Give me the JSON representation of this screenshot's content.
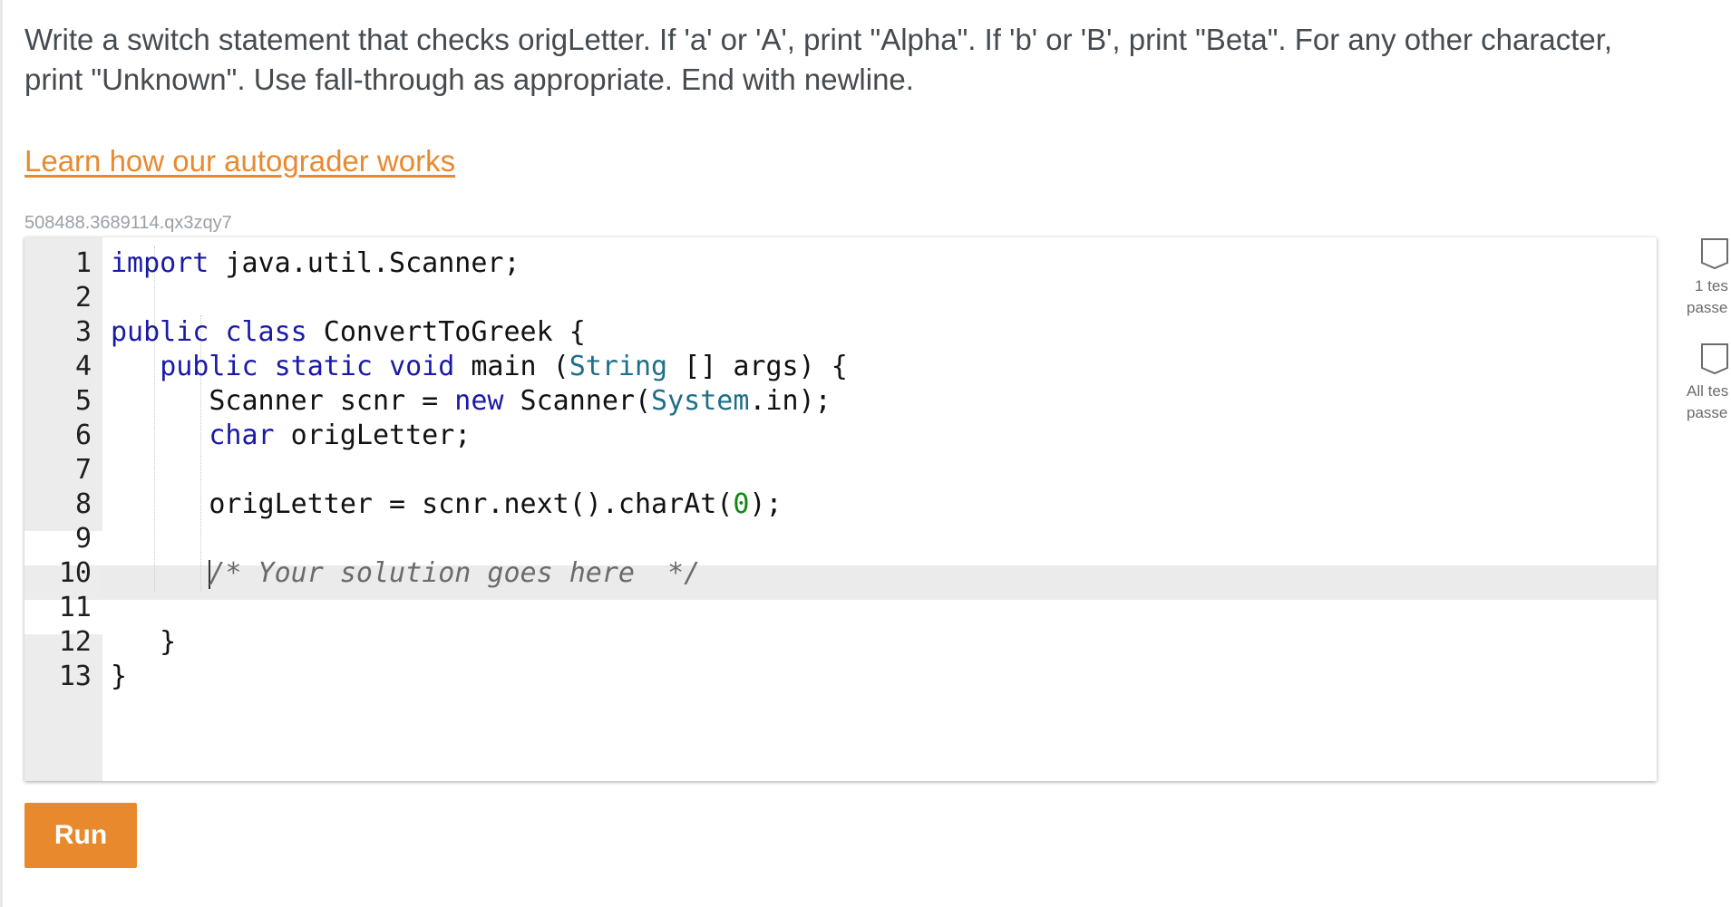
{
  "prompt": {
    "text": "Write a switch statement that checks origLetter. If 'a' or 'A', print \"Alpha\". If 'b' or 'B', print \"Beta\". For any other character, print \"Unknown\". Use fall-through as appropriate. End with newline."
  },
  "learn_link": "Learn how our autograder works",
  "challenge_id": "508488.3689114.qx3zqy7",
  "editor": {
    "active_line": 10,
    "lines": [
      {
        "num": "1",
        "parts": [
          {
            "t": "import",
            "c": "kw"
          },
          {
            "t": " java.util.Scanner;",
            "c": ""
          }
        ]
      },
      {
        "num": "2",
        "parts": []
      },
      {
        "num": "3",
        "parts": [
          {
            "t": "public",
            "c": "kw"
          },
          {
            "t": " ",
            "c": ""
          },
          {
            "t": "class",
            "c": "kw"
          },
          {
            "t": " ConvertToGreek {",
            "c": ""
          }
        ]
      },
      {
        "num": "4",
        "parts": [
          {
            "t": "   ",
            "c": ""
          },
          {
            "t": "public",
            "c": "kw"
          },
          {
            "t": " ",
            "c": ""
          },
          {
            "t": "static",
            "c": "kw"
          },
          {
            "t": " ",
            "c": ""
          },
          {
            "t": "void",
            "c": "kw"
          },
          {
            "t": " main (",
            "c": ""
          },
          {
            "t": "String",
            "c": "ty"
          },
          {
            "t": " [] args) {",
            "c": ""
          }
        ]
      },
      {
        "num": "5",
        "parts": [
          {
            "t": "      Scanner scnr = ",
            "c": ""
          },
          {
            "t": "new",
            "c": "kw"
          },
          {
            "t": " Scanner(",
            "c": ""
          },
          {
            "t": "System",
            "c": "ty"
          },
          {
            "t": ".in);",
            "c": ""
          }
        ]
      },
      {
        "num": "6",
        "parts": [
          {
            "t": "      ",
            "c": ""
          },
          {
            "t": "char",
            "c": "kw"
          },
          {
            "t": " origLetter;",
            "c": ""
          }
        ]
      },
      {
        "num": "7",
        "parts": []
      },
      {
        "num": "8",
        "parts": [
          {
            "t": "      origLetter = scnr.next().charAt(",
            "c": ""
          },
          {
            "t": "0",
            "c": "num"
          },
          {
            "t": ");",
            "c": ""
          }
        ]
      },
      {
        "num": "9",
        "parts": []
      },
      {
        "num": "10",
        "parts": [
          {
            "t": "      ",
            "c": ""
          },
          {
            "t": "|",
            "c": "cursor"
          },
          {
            "t": "/* Your solution goes here  */",
            "c": "cm"
          }
        ]
      },
      {
        "num": "11",
        "parts": []
      },
      {
        "num": "12",
        "parts": [
          {
            "t": "   }",
            "c": ""
          }
        ]
      },
      {
        "num": "13",
        "parts": [
          {
            "t": "}",
            "c": ""
          }
        ]
      }
    ]
  },
  "run_button": "Run",
  "side_panel": {
    "items": [
      {
        "icon": "test-badge-icon",
        "line1": "1 tes",
        "line2": "passe"
      },
      {
        "icon": "test-badge-icon",
        "line1": "All tes",
        "line2": "passe"
      }
    ]
  },
  "colors": {
    "accent": "#e8892e",
    "keyword": "#1a1aa6",
    "type": "#1e6f87",
    "number": "#118811",
    "comment": "#6b6b6b"
  }
}
